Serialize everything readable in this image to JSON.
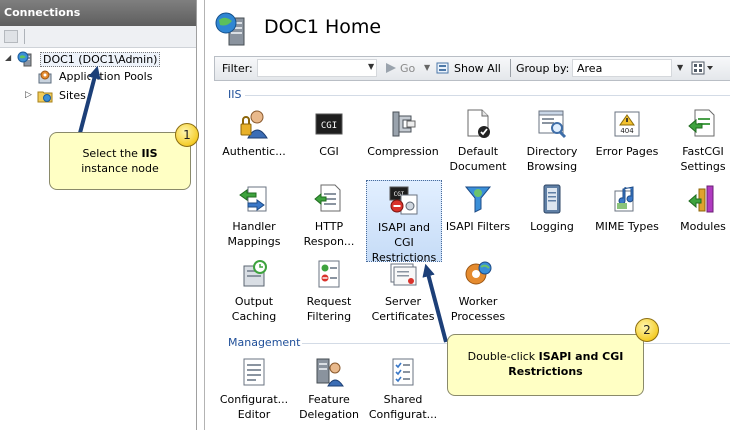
{
  "connections": {
    "header": "Connections",
    "tree": {
      "server": "DOC1 (DOC1\\Admin)",
      "app_pools": "Application Pools",
      "sites": "Sites"
    }
  },
  "main": {
    "title": "DOC1 Home",
    "filter_bar": {
      "filter_label": "Filter:",
      "filter_value": "",
      "go_label": "Go",
      "show_all_label": "Show All",
      "group_by_label": "Group by:",
      "group_by_value": "Area"
    },
    "sections": [
      {
        "label": "IIS",
        "features": [
          {
            "label": "Authentic...",
            "icon": "authentication-icon"
          },
          {
            "label": "CGI",
            "icon": "cgi-icon"
          },
          {
            "label": "Compression",
            "icon": "compression-icon"
          },
          {
            "label": "Default\nDocument",
            "icon": "default-document-icon"
          },
          {
            "label": "Directory\nBrowsing",
            "icon": "directory-browsing-icon"
          },
          {
            "label": "Error Pages",
            "icon": "error-pages-icon"
          },
          {
            "label": "FastCGI\nSettings",
            "icon": "fastcgi-icon"
          },
          {
            "label": "Handler\nMappings",
            "icon": "handler-mappings-icon"
          },
          {
            "label": "HTTP\nRespon...",
            "icon": "http-response-icon"
          },
          {
            "label": "ISAPI and\nCGI\nRestrictions",
            "icon": "isapi-cgi-restrictions-icon"
          },
          {
            "label": "ISAPI Filters",
            "icon": "isapi-filters-icon"
          },
          {
            "label": "Logging",
            "icon": "logging-icon"
          },
          {
            "label": "MIME Types",
            "icon": "mime-types-icon"
          },
          {
            "label": "Modules",
            "icon": "modules-icon"
          },
          {
            "label": "Output\nCaching",
            "icon": "output-caching-icon"
          },
          {
            "label": "Request\nFiltering",
            "icon": "request-filtering-icon"
          },
          {
            "label": "Server\nCertificates",
            "icon": "server-certificates-icon"
          },
          {
            "label": "Worker\nProcesses",
            "icon": "worker-processes-icon"
          }
        ]
      },
      {
        "label": "Management",
        "features": [
          {
            "label": "Configurat...\nEditor",
            "icon": "configuration-editor-icon"
          },
          {
            "label": "Feature\nDelegation",
            "icon": "feature-delegation-icon"
          },
          {
            "label": "Shared\nConfigurat...",
            "icon": "shared-configuration-icon"
          }
        ]
      }
    ]
  },
  "callouts": [
    {
      "number": "1",
      "text_before": "Select the ",
      "text_bold": "IIS",
      "text_after": "instance node"
    },
    {
      "number": "2",
      "text_before": "Double-click ",
      "text_bold": "ISAPI and CGI Restrictions",
      "text_after": ""
    }
  ],
  "colors": {
    "accent": "#1f4f99",
    "callout_fill": "#ffffc4",
    "arrow": "#1c3f78",
    "selection": "#c6dcf7"
  }
}
